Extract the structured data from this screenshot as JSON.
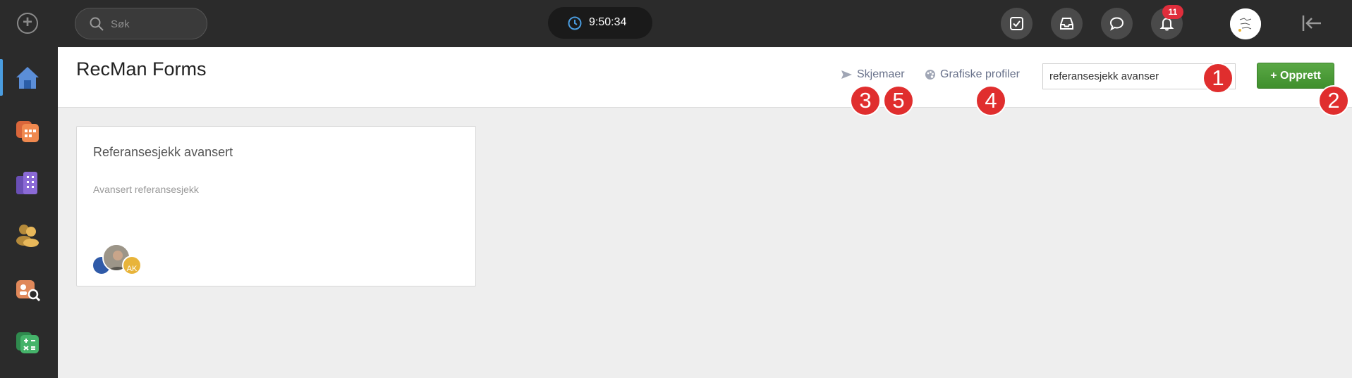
{
  "sidebar": {
    "items": [
      {
        "icon": "home-icon",
        "active": true
      },
      {
        "icon": "calendar-icon",
        "active": false
      },
      {
        "icon": "building-icon",
        "active": false
      },
      {
        "icon": "people-icon",
        "active": false
      },
      {
        "icon": "candidate-search-icon",
        "active": false
      },
      {
        "icon": "calculator-icon",
        "active": false
      }
    ],
    "add_icon": "plus-circle-icon"
  },
  "topbar": {
    "search_placeholder": "Søk",
    "clock_time": "9:50:34",
    "notifications_count": "11"
  },
  "header": {
    "title": "RecMan Forms",
    "nav": {
      "forms_label": "Skjemaer",
      "profiles_label": "Grafiske profiler"
    },
    "filter_value": "referansesjekk avanser",
    "create_label": "+ Opprett"
  },
  "markers": [
    "1",
    "2",
    "3",
    "4",
    "5"
  ],
  "cards": [
    {
      "title": "Referansesjekk avansert",
      "description": "Avansert referansesjekk",
      "avatars": [
        "",
        "",
        "AK"
      ]
    }
  ],
  "colors": {
    "sidebar_bg": "#2b2b2b",
    "accent": "#4a9de0",
    "create_button": "#4b9a37",
    "badge": "#e02e3c",
    "marker": "#e02e2e"
  }
}
